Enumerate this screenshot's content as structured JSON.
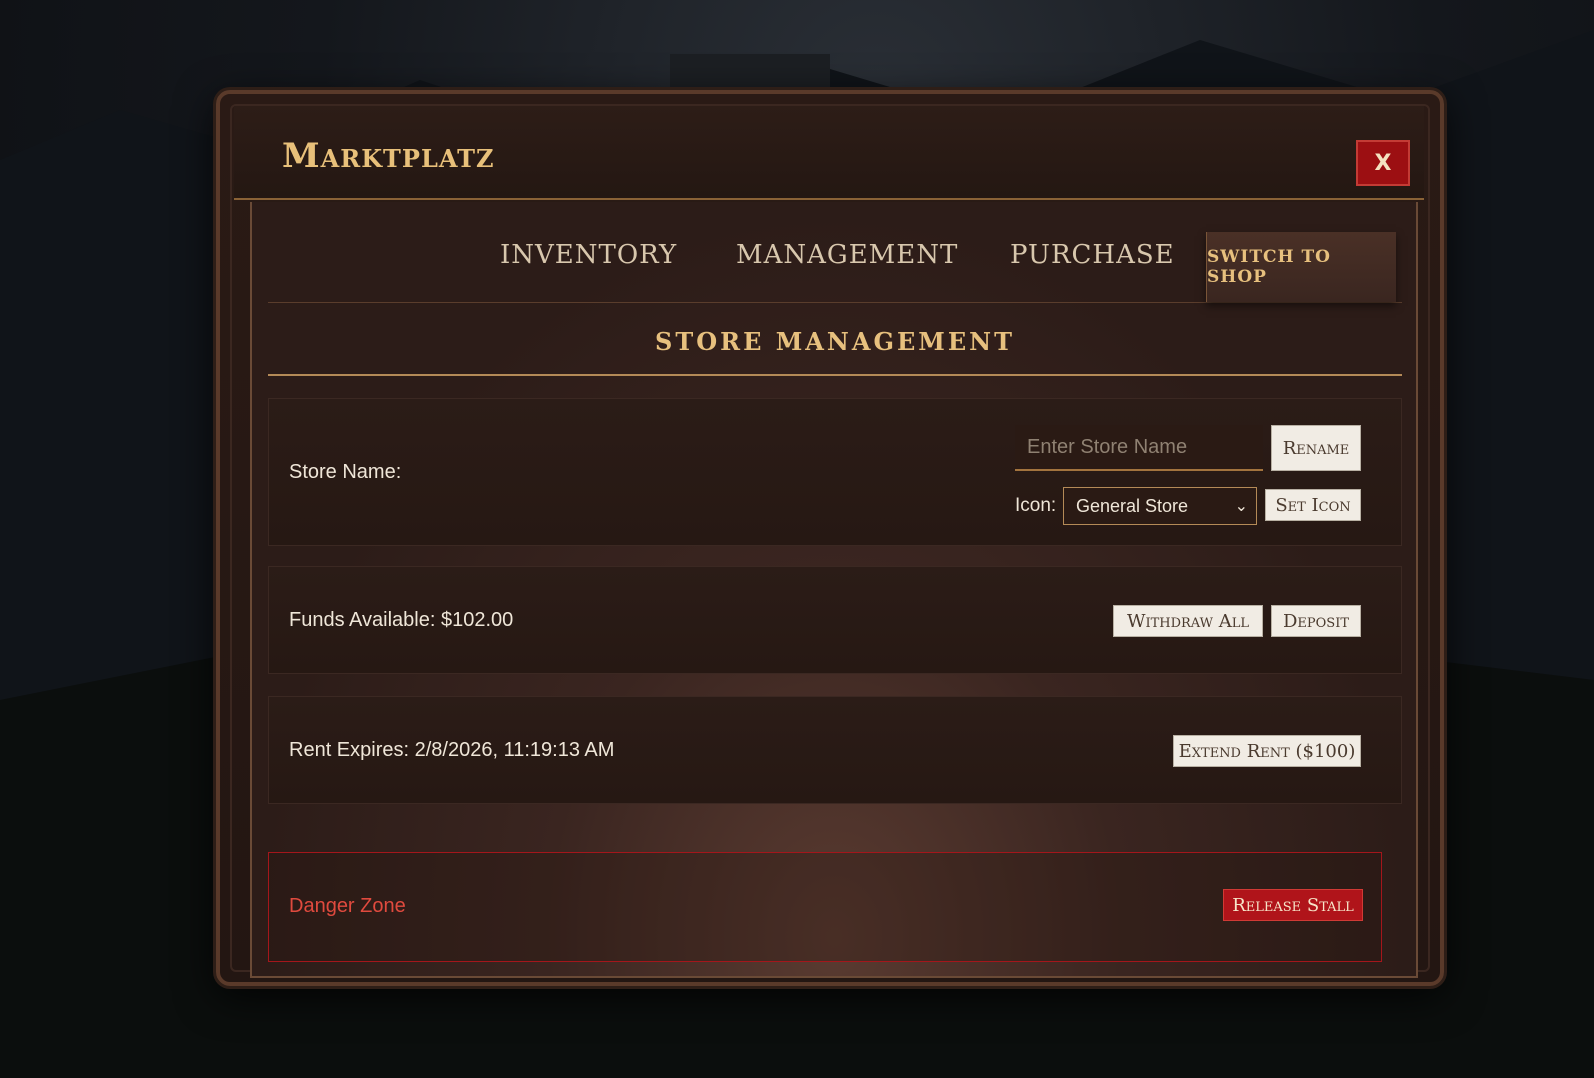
{
  "window": {
    "title": "Marktplatz",
    "close_label": "X"
  },
  "tabs": [
    {
      "label": "INVENTORY"
    },
    {
      "label": "MANAGEMENT"
    },
    {
      "label": "PURCHASE"
    }
  ],
  "switch_label": "SWITCH TO SHOP",
  "section_title": "STORE MANAGEMENT",
  "store_name": {
    "label": "Store Name:",
    "input_placeholder": "Enter Store Name",
    "input_value": "",
    "rename_label": "Rename",
    "icon_label": "Icon:",
    "icon_selected": "General Store",
    "set_icon_label": "Set Icon"
  },
  "funds": {
    "label": "Funds Available: $102.00",
    "withdraw_label": "Withdraw All",
    "deposit_label": "Deposit"
  },
  "rent": {
    "label": "Rent Expires: 2/8/2026, 11:19:13 AM",
    "extend_label": "Extend Rent ($100)"
  },
  "danger": {
    "label": "Danger Zone",
    "release_label": "Release Stall"
  },
  "colors": {
    "accent_gold": "#e7c07e",
    "danger_red": "#b0141a",
    "panel_brown": "#2e1e19"
  }
}
